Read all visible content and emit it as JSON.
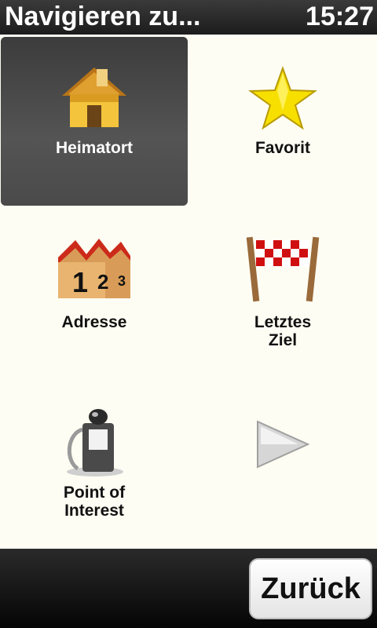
{
  "header": {
    "title": "Navigieren zu...",
    "time": "15:27"
  },
  "menu": [
    {
      "label": "Heimatort",
      "icon": "house-icon",
      "selected": true
    },
    {
      "label": "Favorit",
      "icon": "star-icon",
      "selected": false
    },
    {
      "label": "Adresse",
      "icon": "address-numbers-icon",
      "selected": false
    },
    {
      "label": "Letztes\nZiel",
      "icon": "checkered-finish-flag-icon",
      "selected": false
    },
    {
      "label": "Point of\nInterest",
      "icon": "gas-pump-icon",
      "selected": false
    },
    {
      "label": "",
      "icon": "next-arrow-icon",
      "selected": false
    }
  ],
  "footer": {
    "back_label": "Zurück"
  },
  "colors": {
    "header_bg": "#1c1c1c",
    "selected_bg": "#4a4a4a",
    "content_bg": "#fdfdf3"
  }
}
